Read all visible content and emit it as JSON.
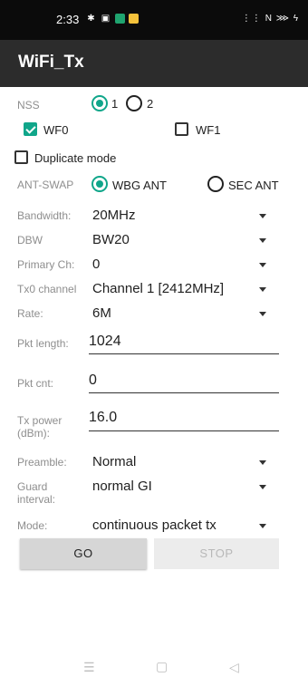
{
  "status_bar": {
    "time": "2:33",
    "right_indicators": "⋮⋮ N ⋙ ϟ"
  },
  "app": {
    "title": "WiFi_Tx"
  },
  "nss": {
    "label": "NSS",
    "options": [
      "1",
      "2"
    ],
    "selected": "1"
  },
  "wf": {
    "wf0_label": "WF0",
    "wf0_checked": true,
    "wf1_label": "WF1",
    "wf1_checked": false
  },
  "duplicate": {
    "label": "Duplicate mode",
    "checked": false
  },
  "ant_swap": {
    "label": "ANT-SWAP",
    "options": [
      "WBG ANT",
      "SEC ANT"
    ],
    "selected": "WBG ANT"
  },
  "fields": {
    "bandwidth": {
      "label": "Bandwidth:",
      "value": "20MHz"
    },
    "dbw": {
      "label": "DBW",
      "value": "BW20"
    },
    "primary_ch": {
      "label": "Primary Ch:",
      "value": "0"
    },
    "tx0_channel": {
      "label": "Tx0 channel",
      "value": "Channel 1 [2412MHz]"
    },
    "rate": {
      "label": "Rate:",
      "value": "6M"
    },
    "pkt_length": {
      "label": "Pkt length:",
      "value": "1024"
    },
    "pkt_cnt": {
      "label": "Pkt cnt:",
      "value": "0"
    },
    "tx_power": {
      "label_line1": "Tx power",
      "label_line2": "(dBm):",
      "value": "16.0"
    },
    "preamble": {
      "label": "Preamble:",
      "value": "Normal"
    },
    "guard_interval": {
      "label_line1": "Guard",
      "label_line2": "interval:",
      "value": "normal GI"
    },
    "mode": {
      "label": "Mode:",
      "value": "continuous packet tx"
    }
  },
  "buttons": {
    "go": "GO",
    "stop": "STOP"
  },
  "colors": {
    "accent": "#10a68a",
    "toolbar": "#2c2c2c",
    "status_bar": "#0b0b0b"
  }
}
